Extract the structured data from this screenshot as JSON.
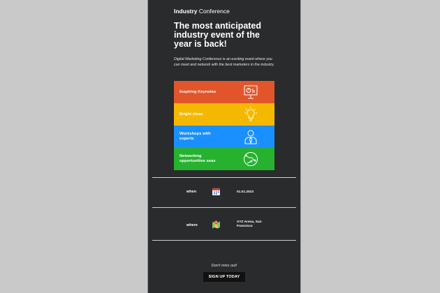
{
  "brand": {
    "bold": "Industry",
    "rest": " Conference"
  },
  "headline": "The most anticipated industry event of the year is back!",
  "intro": "Digital Marketing Conference is an exciting event where you can meet and network with the best marketers in the industry.",
  "features": [
    {
      "label": "Inspiring Keynotes",
      "color": "#e2552b",
      "icon": "presentation-icon"
    },
    {
      "label": "Bright ideas",
      "color": "#f5b800",
      "icon": "lightbulb-icon"
    },
    {
      "label": "Workshops with experts",
      "color": "#1a90ff",
      "icon": "person-icon"
    },
    {
      "label": "Networking opportunities seas",
      "color": "#26b22f",
      "icon": "globe-icon"
    }
  ],
  "when": {
    "label": "when",
    "value": "01.01.2023",
    "icon": "calendar-icon"
  },
  "where": {
    "label": "where",
    "value": "XYZ Arena, San Francisco",
    "icon": "map-icon"
  },
  "footer": {
    "miss": "Don't miss out!",
    "cta": "SIGN UP TODAY"
  }
}
